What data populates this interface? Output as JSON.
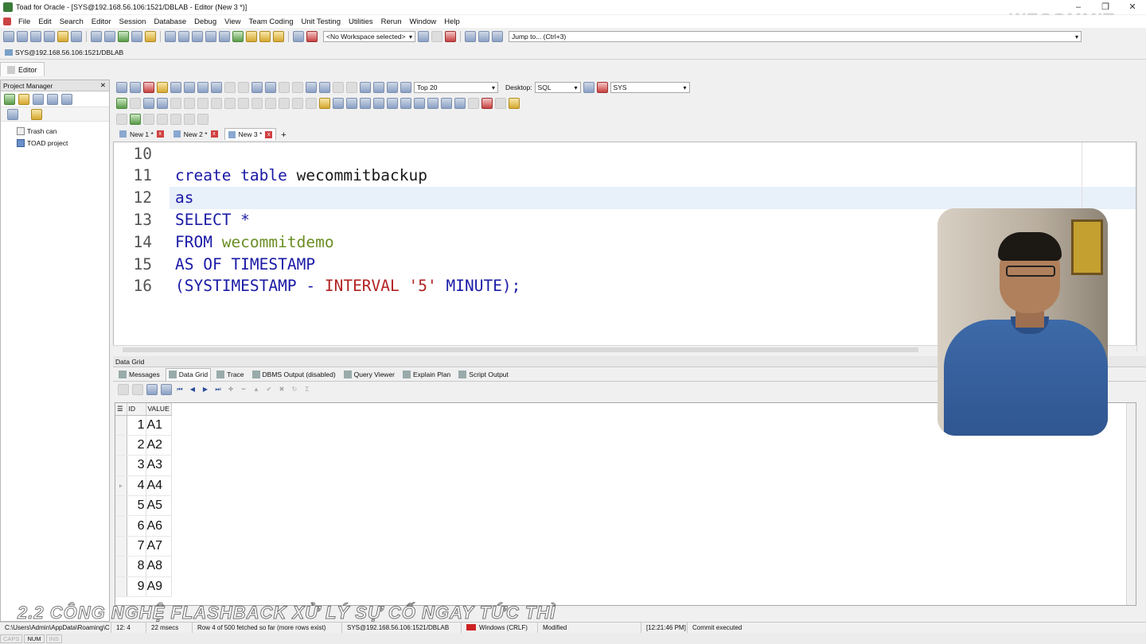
{
  "window": {
    "title": "Toad for Oracle - [SYS@192.168.56.106:1521/DBLAB - Editor (New 3 *)]",
    "controls": [
      "–",
      "❐",
      "✕"
    ]
  },
  "menu": [
    "File",
    "Edit",
    "Search",
    "Editor",
    "Session",
    "Database",
    "Debug",
    "View",
    "Team Coding",
    "Unit Testing",
    "Utilities",
    "Rerun",
    "Window",
    "Help"
  ],
  "toolbar": {
    "workspace": "<No Workspace selected>",
    "jump_to": "Jump to... (Ctrl+3)"
  },
  "connection": "SYS@192.168.56.106:1521/DBLAB",
  "editor_tab": "Editor",
  "project_manager": {
    "title": "Project Manager",
    "close": "✕",
    "items": [
      "Trash can",
      "TOAD project"
    ]
  },
  "editor_toolbar": {
    "top_rows": "Top 20",
    "desktop_label": "Desktop:",
    "desktop_value": "SQL",
    "schema": "SYS"
  },
  "doc_tabs": [
    {
      "label": "New 1 *"
    },
    {
      "label": "New 2 *"
    },
    {
      "label": "New 3 *"
    }
  ],
  "doc_tabs_add": "+",
  "code_lines": [
    {
      "num": "10",
      "tokens": []
    },
    {
      "num": "11",
      "tokens": [
        {
          "t": "create table ",
          "c": "kw"
        },
        {
          "t": "wecommitbackup",
          "c": "ident"
        }
      ]
    },
    {
      "num": "12",
      "tokens": [
        {
          "t": "as",
          "c": "kw"
        }
      ]
    },
    {
      "num": "13",
      "tokens": [
        {
          "t": "SELECT *",
          "c": "kw"
        }
      ]
    },
    {
      "num": "14",
      "tokens": [
        {
          "t": "FROM ",
          "c": "kw"
        },
        {
          "t": "wecommitdemo",
          "c": "tbl"
        }
      ]
    },
    {
      "num": "15",
      "tokens": [
        {
          "t": "AS OF TIMESTAMP",
          "c": "kw"
        }
      ]
    },
    {
      "num": "16",
      "tokens": [
        {
          "t": "(SYSTIMESTAMP - ",
          "c": "cm"
        },
        {
          "t": "INTERVAL ",
          "c": "fn"
        },
        {
          "t": "'5'",
          "c": "str"
        },
        {
          "t": " MINUTE);",
          "c": "cm"
        }
      ]
    }
  ],
  "data_grid": {
    "title": "Data Grid",
    "tabs": [
      "Messages",
      "Data Grid",
      "Trace",
      "DBMS Output (disabled)",
      "Query Viewer",
      "Explain Plan",
      "Script Output"
    ],
    "columns": [
      "ID",
      "VALUE"
    ],
    "rows": [
      {
        "id": "1",
        "value": "A1"
      },
      {
        "id": "2",
        "value": "A2"
      },
      {
        "id": "3",
        "value": "A3"
      },
      {
        "id": "4",
        "value": "A4"
      },
      {
        "id": "5",
        "value": "A5"
      },
      {
        "id": "6",
        "value": "A6"
      },
      {
        "id": "7",
        "value": "A7"
      },
      {
        "id": "8",
        "value": "A8"
      },
      {
        "id": "9",
        "value": "A9"
      }
    ],
    "current_row_marker": "▹"
  },
  "status_bar": {
    "path": "C:\\Users\\Admin\\AppData\\Roaming\\C",
    "position": "12: 4",
    "time": "22 msecs",
    "rows": "Row 4 of 500 fetched so far (more rows exist)",
    "connection": "SYS@192.168.56.106:1521/DBLAB",
    "line_ending": "Windows (CRLF)",
    "modified": "Modified",
    "timestamp": "[12:21:46 PM]",
    "message": "Commit executed"
  },
  "keys": [
    "CAPS",
    "NUM",
    "INS"
  ],
  "caption": "2.2 CÔNG NGHỆ FLASHBACK XỬ LÝ SỰ CỐ NGAY TỨC THÌ",
  "watermark": "WECOMMIT"
}
